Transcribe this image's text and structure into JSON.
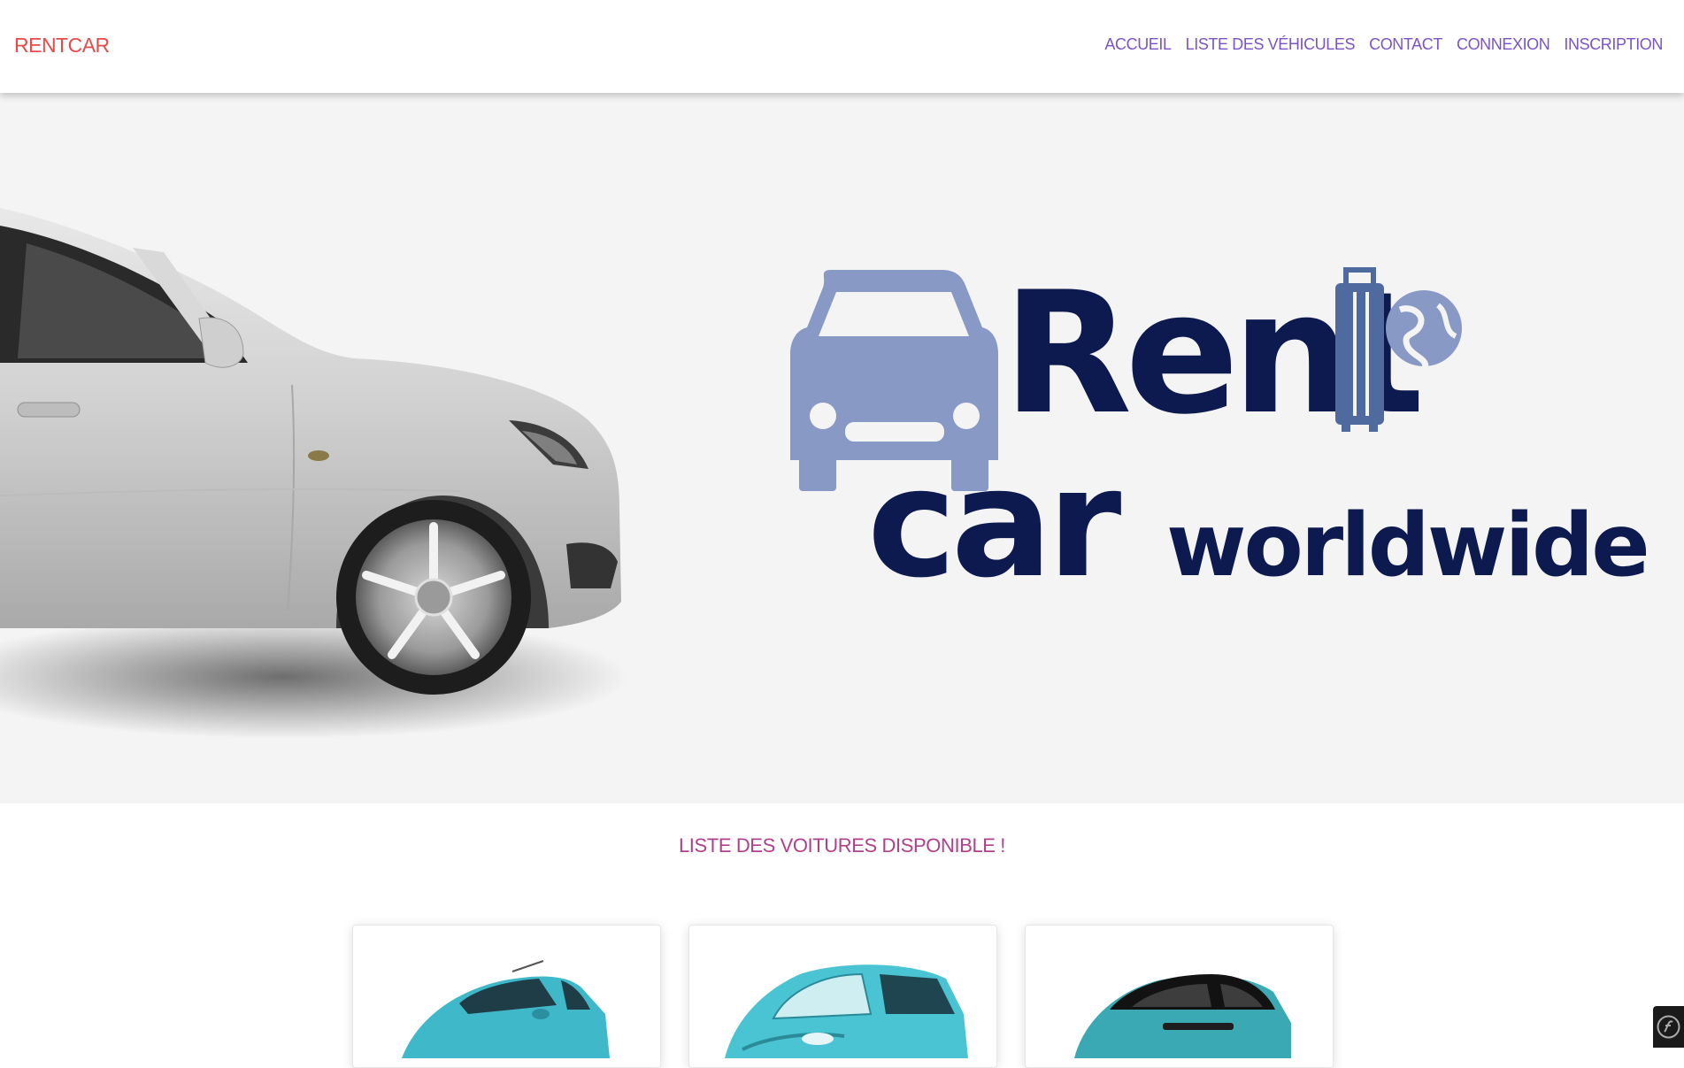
{
  "navbar": {
    "brand": "RENTCAR",
    "links": [
      {
        "label": "ACCUEIL"
      },
      {
        "label": "LISTE DES VÉHICULES"
      },
      {
        "label": "CONTACT"
      },
      {
        "label": "CONNEXION"
      },
      {
        "label": "INSCRIPTION"
      }
    ]
  },
  "hero": {
    "logo_word_1": "Rent",
    "logo_word_2": "car",
    "logo_word_3": "worldwide"
  },
  "main": {
    "section_title": "LISTE DES VOITURES DISPONIBLE !",
    "cards": [
      {
        "image": "car-thumbnail"
      },
      {
        "image": "car-thumbnail"
      },
      {
        "image": "car-thumbnail"
      }
    ]
  },
  "colors": {
    "brand": "#e84a4a",
    "nav_link": "#7a54c7",
    "section_title": "#b0408c",
    "logo_dark": "#0d1a4f",
    "logo_light": "#8799c4",
    "logo_mid": "#4e6a9e",
    "car_teal": "#3fb8c9"
  },
  "icons": {
    "symfony_toolbar": "symfony-icon"
  }
}
